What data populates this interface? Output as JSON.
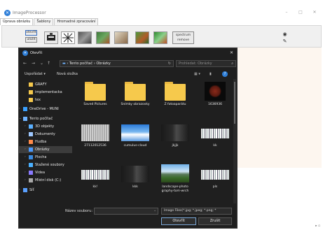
{
  "window": {
    "title": "ImageProcessor",
    "app_icon": "app-logo-icon",
    "controls": [
      "–",
      "□",
      "✕"
    ]
  },
  "tabs": [
    {
      "label": "Úprava obrázku",
      "active": true
    },
    {
      "label": "Šablony",
      "active": false
    },
    {
      "label": "Hromadné zpracování",
      "active": false
    }
  ],
  "toolbar": {
    "btn_top": "otevřít",
    "btn_bottom": "uložit",
    "spectrum_line1": "spectrum",
    "spectrum_line2": "remove"
  },
  "dialog": {
    "title": "Otevřít",
    "close": "✕",
    "address": {
      "pc": "Tento počítač",
      "sep": "›",
      "folder": "Obrázky"
    },
    "search_placeholder": "Prohledat: Obrázky",
    "commands": {
      "organize": "Uspořádat ▾",
      "new_folder": "Nová složka"
    },
    "nav_items": [
      {
        "label": "GRAFY",
        "icon": "folder",
        "indent": 1
      },
      {
        "label": "implementacka",
        "icon": "folder",
        "indent": 1
      },
      {
        "label": "tex",
        "icon": "folder",
        "indent": 1
      },
      {
        "label": "OneDrive - MUNI",
        "icon": "cloud",
        "indent": 0
      },
      {
        "label": "Tento počítač",
        "icon": "pc",
        "indent": 0
      },
      {
        "label": "3D objekty",
        "icon": "cube",
        "indent": 1
      },
      {
        "label": "Dokumenty",
        "icon": "docs",
        "indent": 1
      },
      {
        "label": "Hudba",
        "icon": "music",
        "indent": 1
      },
      {
        "label": "Obrázky",
        "icon": "pictures",
        "indent": 1,
        "selected": true
      },
      {
        "label": "Plocha",
        "icon": "desktop",
        "indent": 1
      },
      {
        "label": "Stažené soubory",
        "icon": "download",
        "indent": 1
      },
      {
        "label": "Videa",
        "icon": "video",
        "indent": 1
      },
      {
        "label": "Místní disk (C:)",
        "icon": "disk",
        "indent": 1
      },
      {
        "label": "Síť",
        "icon": "network",
        "indent": 0
      }
    ],
    "files": [
      {
        "label": "Saved Pictures",
        "kind": "folder"
      },
      {
        "label": "Snímky obrazovky",
        "kind": "folder"
      },
      {
        "label": "Z fotoaparátu",
        "kind": "folder"
      },
      {
        "label": "1636936",
        "kind": "moon"
      },
      {
        "label": "27112012536",
        "kind": "noise"
      },
      {
        "label": "cumulus-cloud",
        "kind": "sky"
      },
      {
        "label": "jkjjk",
        "kind": "dark"
      },
      {
        "label": "kk",
        "kind": "stripes"
      },
      {
        "label": "kk!",
        "kind": "stripes"
      },
      {
        "label": "kkk",
        "kind": "dark"
      },
      {
        "label": "landscape-photo graphy-tom-wrch",
        "kind": "landscape"
      },
      {
        "label": "pls",
        "kind": "stripes"
      }
    ],
    "filename_label": "Název souboru:",
    "filetype": "Image Files(*.jpg; *.jpeg; *.png; *",
    "open_label": "Otevřít",
    "cancel_label": "Zrušit"
  },
  "colors": {
    "accent": "#2f7fd8",
    "dialog_bg": "#1f1f1f",
    "folder": "#f6c94c",
    "canvas": "#fdf6ef"
  }
}
